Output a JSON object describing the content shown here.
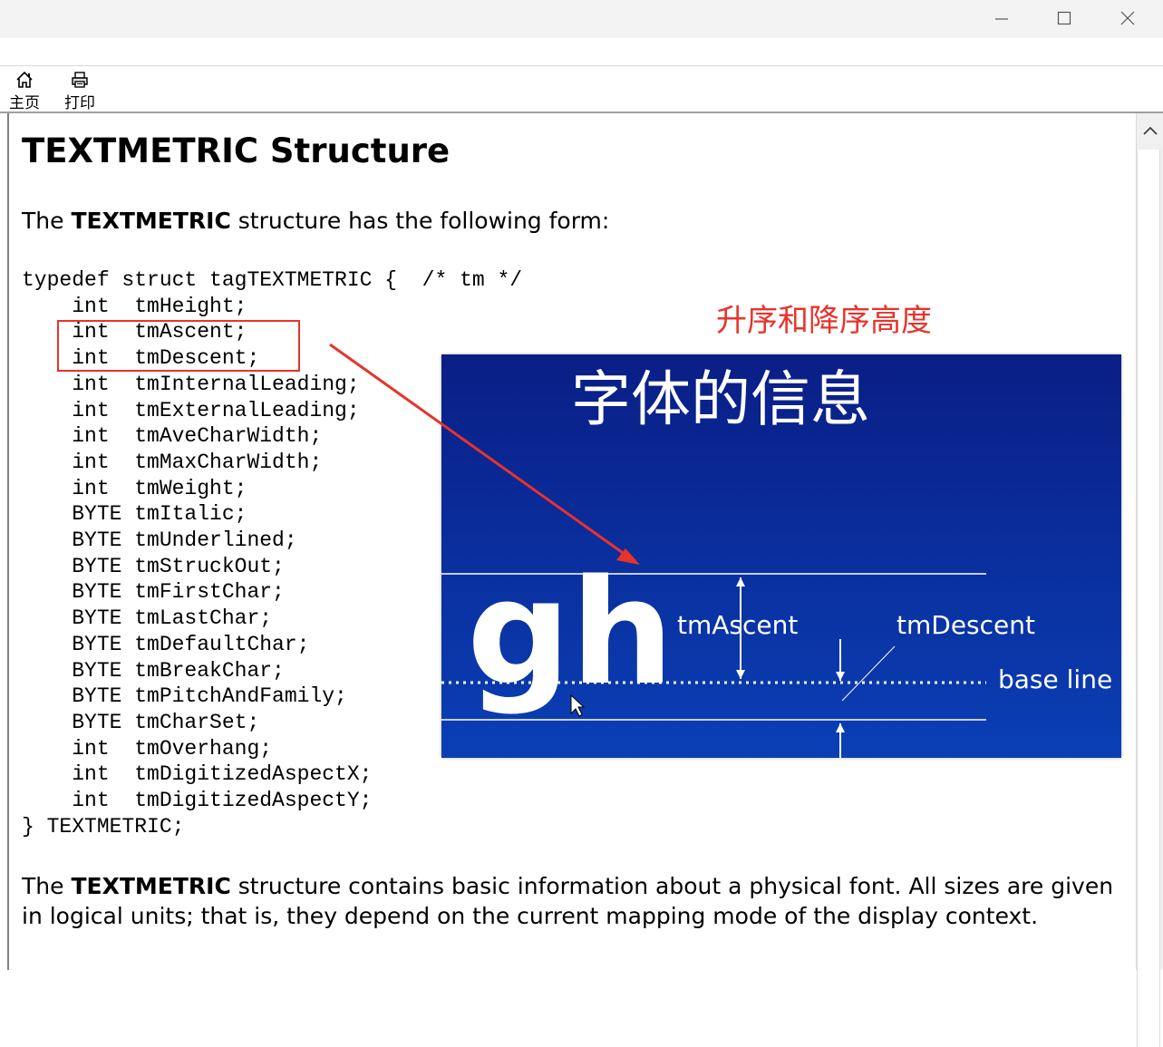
{
  "window": {
    "controls": {
      "minimize_icon": "minimize-icon",
      "maximize_icon": "maximize-icon",
      "close_icon": "close-icon"
    }
  },
  "toolbar": {
    "home_label": "主页",
    "home_icon": "home-icon",
    "print_label": "打印",
    "print_icon": "printer-icon"
  },
  "document": {
    "title": "TEXTMETRIC Structure",
    "intro_pre": "The ",
    "intro_bold": "TEXTMETRIC",
    "intro_post": " structure has the following form:",
    "code_lines": [
      "typedef struct tagTEXTMETRIC {  /* tm */",
      "    int  tmHeight;",
      "    int  tmAscent;",
      "    int  tmDescent;",
      "    int  tmInternalLeading;",
      "    int  tmExternalLeading;",
      "    int  tmAveCharWidth;",
      "    int  tmMaxCharWidth;",
      "    int  tmWeight;",
      "    BYTE tmItalic;",
      "    BYTE tmUnderlined;",
      "    BYTE tmStruckOut;",
      "    BYTE tmFirstChar;",
      "    BYTE tmLastChar;",
      "    BYTE tmDefaultChar;",
      "    BYTE tmBreakChar;",
      "    BYTE tmPitchAndFamily;",
      "    BYTE tmCharSet;",
      "    int  tmOverhang;",
      "    int  tmDigitizedAspectX;",
      "    int  tmDigitizedAspectY;",
      "} TEXTMETRIC;"
    ],
    "para_pre": "The ",
    "para_bold": "TEXTMETRIC",
    "para_post": " structure contains basic information about a physical font. All sizes are given in logical units; that is, they depend on the current mapping mode of the display context."
  },
  "annotation": {
    "label": "升序和降序高度",
    "color": "#e8332b"
  },
  "diagram": {
    "title": "字体的信息",
    "glyphs": "gh",
    "ascent_label": "tmAscent",
    "descent_label": "tmDescent",
    "baseline_label": "base line",
    "bg_top": "#0a1e86",
    "bg_bottom": "#0a40b8"
  }
}
